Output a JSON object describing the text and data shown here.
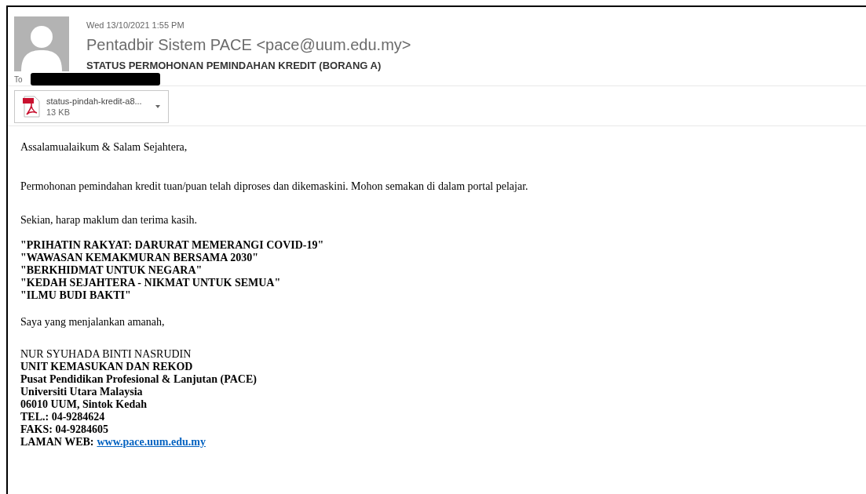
{
  "message": {
    "date": "Wed 13/10/2021 1:55 PM",
    "sender": "Pentadbir Sistem PACE <pace@uum.edu.my>",
    "subject": "STATUS PERMOHONAN PEMINDAHAN KREDIT (BORANG A)",
    "to_label": "To"
  },
  "attachment": {
    "name": "status-pindah-kredit-a8...",
    "size": "13 KB"
  },
  "body": {
    "greeting": "Assalamualaikum & Salam Sejahtera,",
    "paragraphs": [
      "Permohonan pemindahan kredit tuan/puan telah diproses dan dikemaskini. Mohon semakan di dalam portal pelajar.",
      "Sekian, harap maklum dan terima kasih."
    ],
    "slogans": [
      "\"PRIHATIN RAKYAT: DARURAT MEMERANGI COVID-19\"",
      "\"WAWASAN KEMAKMURAN BERSAMA 2030\"",
      "\"BERKHIDMAT UNTUK NEGARA\"",
      "\"KEDAH SEJAHTERA - NIKMAT UNTUK SEMUA\"",
      "\"ILMU BUDI BAKTI\""
    ],
    "closing": "Saya yang menjalankan amanah,",
    "signature": [
      {
        "text": "NUR SYUHADA BINTI NASRUDIN",
        "bold": false
      },
      {
        "text": "UNIT KEMASUKAN DAN REKOD",
        "bold": true
      },
      {
        "text": "Pusat Pendidikan Profesional & Lanjutan (PACE)",
        "bold": true
      },
      {
        "text": "Universiti Utara Malaysia",
        "bold": true
      },
      {
        "text": "06010 UUM, Sintok Kedah",
        "bold": true
      },
      {
        "text": "TEL.: 04-9284624",
        "bold": true
      },
      {
        "text": "FAKS: 04-9284605",
        "bold": true
      }
    ],
    "website": {
      "label": "LAMAN WEB:",
      "link": "www.pace.uum.edu.my"
    }
  }
}
